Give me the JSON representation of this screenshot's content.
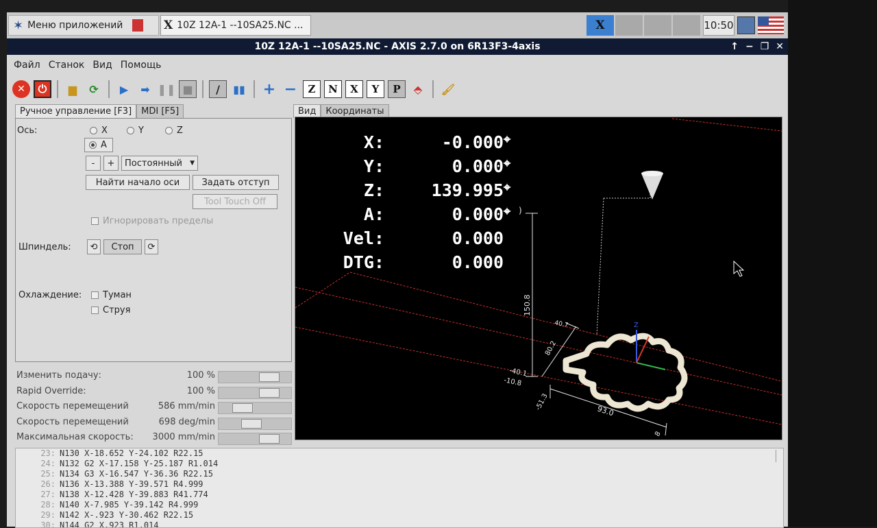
{
  "taskbar": {
    "apps_menu_label": "Меню приложений",
    "window_button_label": "10Z 12A-1 --10SA25.NC ...",
    "clock": "10:50"
  },
  "window": {
    "title": "10Z 12A-1 --10SA25.NC - AXIS 2.7.0 on 6R13F3-4axis"
  },
  "menu": [
    "Файл",
    "Станок",
    "Вид",
    "Помощь"
  ],
  "toolbar": {
    "axis_buttons": [
      "Z",
      "N",
      "X",
      "Y",
      "P"
    ]
  },
  "left_tabs": [
    "Ручное управление [F3]",
    "MDI [F5]"
  ],
  "manual": {
    "axis_label": "Ось:",
    "axes": [
      "X",
      "Y",
      "Z",
      "A"
    ],
    "selected_axis": "A",
    "minus": "-",
    "plus": "+",
    "jog_mode": "Постоянный",
    "home_button": "Найти начало оси",
    "offset_button": "Задать отступ",
    "tool_touch_off": "Tool Touch Off",
    "ignore_limits": "Игнорировать пределы",
    "spindle_label": "Шпиндель:",
    "spindle_stop": "Стоп",
    "coolant_label": "Охлаждение:",
    "mist": "Туман",
    "flood": "Струя"
  },
  "sliders": [
    {
      "name": "Изменить подачу:",
      "value": "100 %",
      "level": 0.8
    },
    {
      "name": "Rapid Override:",
      "value": "100 %",
      "level": 0.8
    },
    {
      "name": "Скорость перемещений",
      "value": "586 mm/min",
      "level": 0.27
    },
    {
      "name": "Скорость перемещений",
      "value": "698 deg/min",
      "level": 0.45
    },
    {
      "name": "Максимальная скорость:",
      "value": "3000 mm/min",
      "level": 0.8
    }
  ],
  "right_tabs": [
    "Вид",
    "Координаты"
  ],
  "dro": [
    {
      "name": "X:",
      "value": "-0.000"
    },
    {
      "name": "Y:",
      "value": "0.000"
    },
    {
      "name": "Z:",
      "value": "139.995"
    },
    {
      "name": "A:",
      "value": "0.000"
    },
    {
      "name": "Vel:",
      "value": "0.000"
    },
    {
      "name": "DTG:",
      "value": "0.000"
    }
  ],
  "dims": {
    "height": "150.8",
    "depth": "80.2",
    "top": "40.7",
    "left_a": "-40.1",
    "left_b": "-10.8",
    "width_start": "-51.3",
    "width": "93.0",
    "width_end": "8"
  },
  "gcode": [
    {
      "n": "23:",
      "text": "N130 X-18.652 Y-24.102 R22.15"
    },
    {
      "n": "24:",
      "text": "N132 G2 X-17.158 Y-25.187 R1.014"
    },
    {
      "n": "25:",
      "text": "N134 G3 X-16.547 Y-36.36 R22.15"
    },
    {
      "n": "26:",
      "text": "N136 X-13.388 Y-39.571 R4.999"
    },
    {
      "n": "27:",
      "text": "N138 X-12.428 Y-39.883 R41.774"
    },
    {
      "n": "28:",
      "text": "N140 X-7.985 Y-39.142 R4.999"
    },
    {
      "n": "29:",
      "text": "N142 X-.923 Y-30.462 R22.15"
    },
    {
      "n": "30:",
      "text": "N144 G2 X.923 R1.014"
    }
  ],
  "colors": {
    "title_bg": "#101b33",
    "view_bg": "#000000",
    "dimension": "#e8e8e8",
    "limit_line": "#c8322a"
  }
}
